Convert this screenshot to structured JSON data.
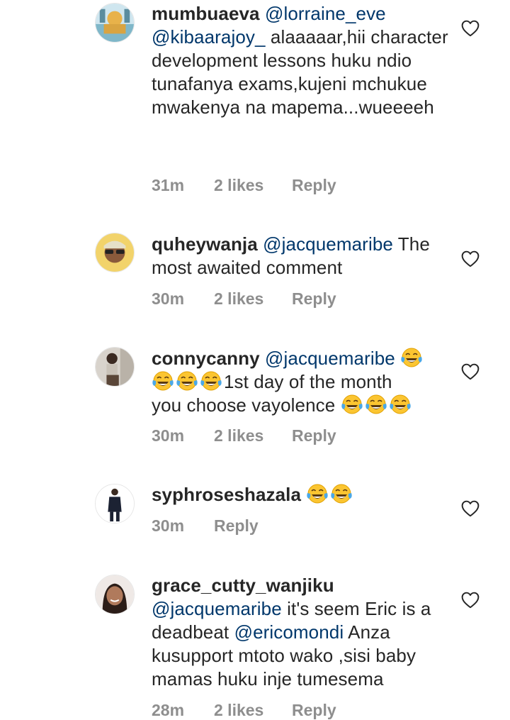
{
  "comments": [
    {
      "username": "mumbuaeva",
      "mention1": "@lorraine_eve",
      "mention2": "@kibaarajoy_",
      "text": " alaaaaar,hii character development lessons huku ndio tunafanya exams,kujeni mchukue mwakenya na mapema...wueeeeh",
      "time": "31m",
      "likes": "2 likes",
      "reply": "Reply"
    },
    {
      "username": "quheywanja",
      "mention1": "@jacquemaribe",
      "text": " The most awaited comment",
      "time": "30m",
      "likes": "2 likes",
      "reply": "Reply"
    },
    {
      "username": "connycanny",
      "mention1": "@jacquemaribe",
      "text1": "1st day of the month",
      "text2": "you choose vayolence ",
      "time": "30m",
      "likes": "2 likes",
      "reply": "Reply"
    },
    {
      "username": "syphroseshazala",
      "time": "30m",
      "reply": "Reply"
    },
    {
      "username": "grace_cutty_wanjiku",
      "mention1": "@jacquemaribe",
      "text1": " it's seem Eric is a deadbeat ",
      "mention2": "@ericomondi",
      "text2": " Anza kusupport mtoto wako ,sisi baby mamas huku inje tumesema",
      "time": "28m",
      "likes": "2 likes",
      "reply": "Reply"
    }
  ],
  "icons": {
    "emoji": "face-with-tears-of-joy-icon",
    "like": "heart-outline-icon"
  },
  "colors": {
    "text": "#262626",
    "mention": "#00376b",
    "meta": "#8e8e8e"
  }
}
